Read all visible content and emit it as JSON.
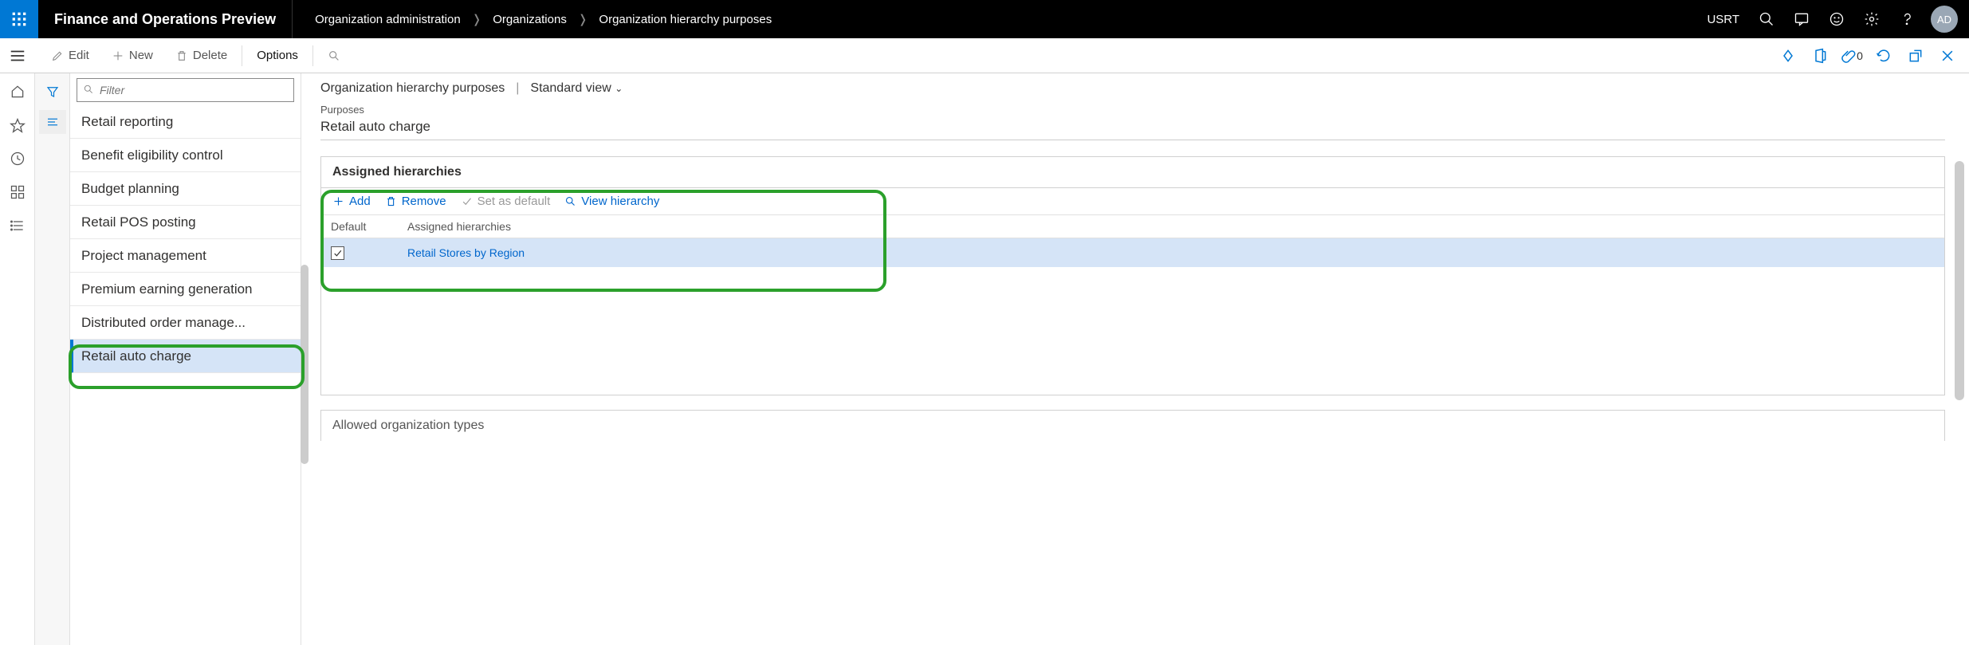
{
  "topbar": {
    "app_title": "Finance and Operations Preview",
    "breadcrumbs": [
      "Organization administration",
      "Organizations",
      "Organization hierarchy purposes"
    ],
    "company_code": "USRT",
    "avatar_initials": "AD"
  },
  "actionbar": {
    "edit": "Edit",
    "new": "New",
    "delete": "Delete",
    "options": "Options"
  },
  "list": {
    "filter_placeholder": "Filter",
    "items": [
      "Retail reporting",
      "Benefit eligibility control",
      "Budget planning",
      "Retail POS posting",
      "Project management",
      "Premium earning generation",
      "Distributed order manage...",
      "Retail auto charge"
    ],
    "selected_index": 7
  },
  "main": {
    "page_title": "Organization hierarchy purposes",
    "view_label": "Standard view",
    "purposes_label": "Purposes",
    "purposes_value": "Retail auto charge",
    "panel_title": "Assigned hierarchies",
    "toolbar": {
      "add": "Add",
      "remove": "Remove",
      "set_default": "Set as default",
      "view_hierarchy": "View hierarchy"
    },
    "grid": {
      "col_default": "Default",
      "col_assigned": "Assigned hierarchies",
      "rows": [
        {
          "default": true,
          "name": "Retail Stores by Region"
        }
      ]
    },
    "panel2_title": "Allowed organization types"
  }
}
